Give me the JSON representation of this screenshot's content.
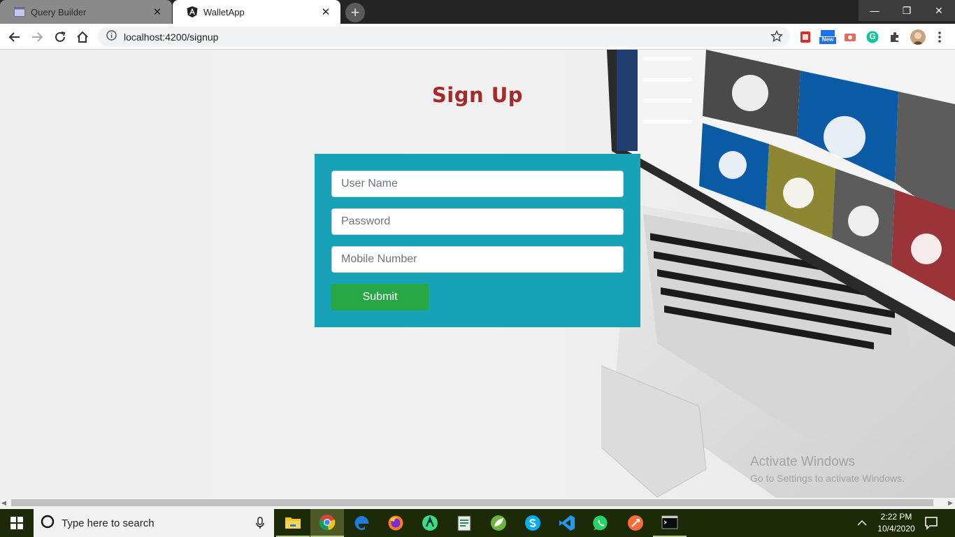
{
  "browser": {
    "tabs": [
      {
        "title": "Query Builder",
        "active": false
      },
      {
        "title": "WalletApp",
        "active": true
      }
    ],
    "close_glyph": "✕",
    "new_tab_glyph": "+",
    "url": "localhost:4200/signup",
    "window_controls": {
      "minimize": "—",
      "maximize": "❐",
      "close": "✕"
    },
    "extensions": [
      "pdf-icon",
      "new-badge-icon",
      "camera-icon",
      "grammarly-icon",
      "puzzle-icon",
      "profile-avatar",
      "menu-icon"
    ],
    "new_badge_text": "New",
    "grammarly_letter": "G"
  },
  "page": {
    "title": "Sign Up",
    "form": {
      "username_placeholder": "User Name",
      "password_placeholder": "Password",
      "mobile_placeholder": "Mobile Number",
      "submit_label": "Submit"
    },
    "watermark": {
      "line1": "Activate Windows",
      "line2": "Go to Settings to activate Windows."
    }
  },
  "taskbar": {
    "search_placeholder": "Type here to search",
    "apps": [
      "file-explorer-icon",
      "chrome-icon",
      "edge-icon",
      "firefox-icon",
      "android-studio-icon",
      "notepad-icon",
      "spring-icon",
      "skype-icon",
      "vscode-icon",
      "whatsapp-icon",
      "postman-icon",
      "terminal-icon"
    ],
    "time": "2:22 PM",
    "date": "10/4/2020"
  },
  "colors": {
    "title": "#a52a2a",
    "form_bg": "#17a2b8",
    "submit_bg": "#28a745",
    "taskbar_bg": "#1d2a07"
  }
}
